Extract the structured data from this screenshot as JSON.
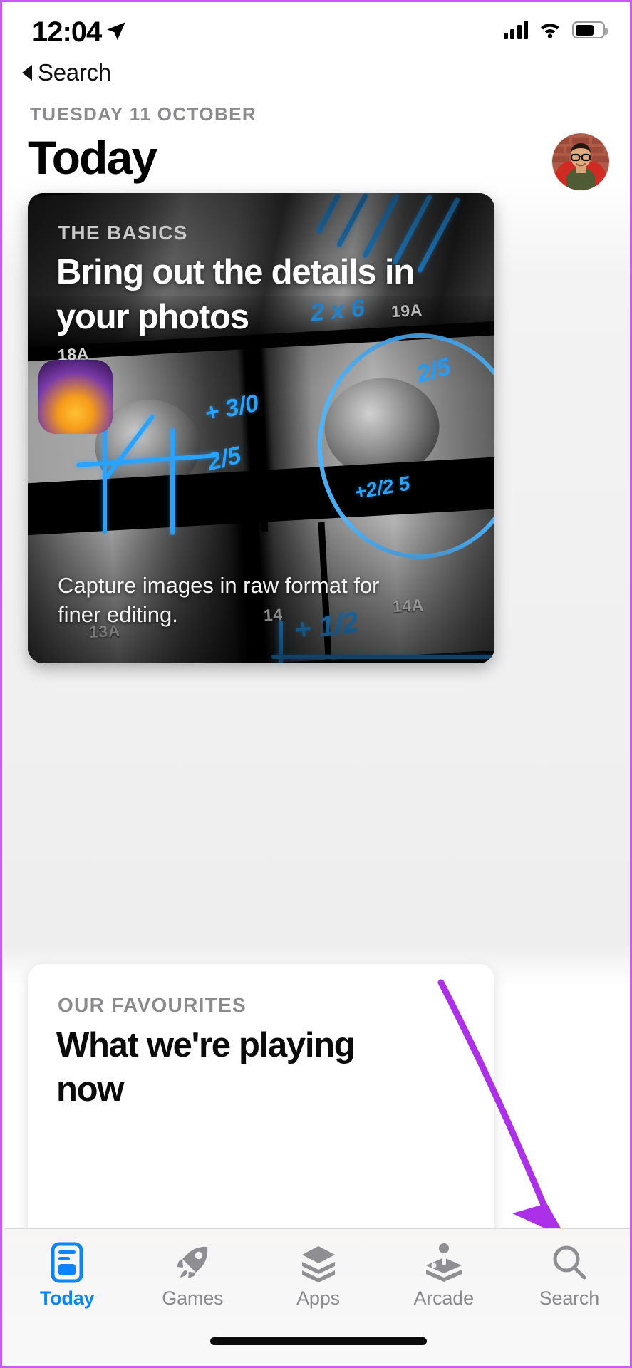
{
  "statusbar": {
    "time": "12:04",
    "location_icon": "location-arrow-icon",
    "cellular_icon": "signal-bars-icon",
    "wifi_icon": "wifi-icon",
    "battery_icon": "battery-icon"
  },
  "back": {
    "label": "Search",
    "icon": "back-caret-icon"
  },
  "header": {
    "eyebrow": "TUESDAY 11 OCTOBER",
    "title": "Today",
    "avatar_alt": "user-profile-photo"
  },
  "hero_card": {
    "kicker": "THE BASICS",
    "title": "Bring out the details in your photos",
    "caption": "Capture images in raw format for finer editing.",
    "sheet_numbers": [
      "18A",
      "19A",
      "13A",
      "14",
      "14A"
    ],
    "ink_marks": [
      "2 x 6",
      "+ 3/0",
      "2/5",
      "2/5",
      "+2/2 5",
      "+ 1/2"
    ],
    "ink_color": "#2aa3ff"
  },
  "second_card": {
    "kicker": "OUR FAVOURITES",
    "title": "What we're playing now"
  },
  "annotation": {
    "type": "arrow",
    "color": "#ab30e8",
    "points_to": "Search",
    "start": "618,1378",
    "end": "790,1733"
  },
  "tabbar": {
    "active": "Today",
    "active_color": "#0a84ff",
    "inactive_color": "#8a8a8e",
    "items": [
      {
        "label": "Today",
        "icon": "today-card-icon"
      },
      {
        "label": "Games",
        "icon": "rocket-icon"
      },
      {
        "label": "Apps",
        "icon": "stacked-layers-icon"
      },
      {
        "label": "Arcade",
        "icon": "joystick-icon"
      },
      {
        "label": "Search",
        "icon": "magnifier-icon"
      }
    ]
  },
  "home_indicator": "home-indicator-bar"
}
